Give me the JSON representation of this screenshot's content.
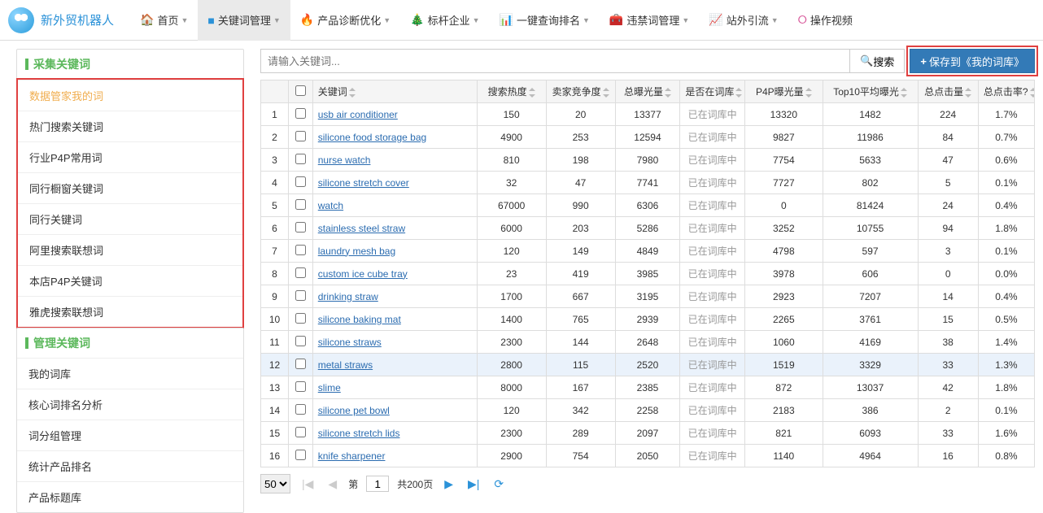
{
  "brand": "新外贸机器人",
  "nav": [
    {
      "label": "首页",
      "icon": "🏠",
      "color": "c-red",
      "caret": true
    },
    {
      "label": "关键词管理",
      "icon": "■",
      "color": "c-blue",
      "caret": true,
      "active": true
    },
    {
      "label": "产品诊断优化",
      "icon": "🔥",
      "color": "c-orange",
      "caret": true
    },
    {
      "label": "标杆企业",
      "icon": "🎄",
      "color": "c-green",
      "caret": true
    },
    {
      "label": "一键查询排名",
      "icon": "📊",
      "color": "c-orange",
      "caret": true
    },
    {
      "label": "违禁词管理",
      "icon": "🧰",
      "color": "c-red",
      "caret": true
    },
    {
      "label": "站外引流",
      "icon": "📈",
      "color": "c-teal",
      "caret": true
    },
    {
      "label": "操作视频",
      "icon": "⭘",
      "color": "c-pink",
      "caret": false
    }
  ],
  "sidebar": {
    "group1": {
      "title": "采集关键词",
      "items": [
        "数据管家我的词",
        "热门搜索关键词",
        "行业P4P常用词",
        "同行橱窗关键词",
        "同行关键词",
        "阿里搜索联想词",
        "本店P4P关键词",
        "雅虎搜索联想词"
      ]
    },
    "group2": {
      "title": "管理关键词",
      "items": [
        "我的词库",
        "核心词排名分析",
        "词分组管理",
        "统计产品排名",
        "产品标题库"
      ]
    }
  },
  "search": {
    "placeholder": "请输入关键词...",
    "btn_label": "搜索",
    "save_label": "保存到《我的词库》"
  },
  "columns": [
    "",
    "",
    "关键词",
    "搜索热度",
    "卖家竞争度",
    "总曝光量",
    "是否在词库",
    "P4P曝光量",
    "Top10平均曝光",
    "总点击量",
    "总点击率?"
  ],
  "rows": [
    {
      "n": 1,
      "kw": "usb air conditioner",
      "heat": "150",
      "comp": "20",
      "expo": "13377",
      "lib": "已在词库中",
      "p4p": "13320",
      "top10": "1482",
      "clk": "224",
      "ctr": "1.7%"
    },
    {
      "n": 2,
      "kw": "silicone food storage bag",
      "heat": "4900",
      "comp": "253",
      "expo": "12594",
      "lib": "已在词库中",
      "p4p": "9827",
      "top10": "11986",
      "clk": "84",
      "ctr": "0.7%"
    },
    {
      "n": 3,
      "kw": "nurse watch",
      "heat": "810",
      "comp": "198",
      "expo": "7980",
      "lib": "已在词库中",
      "p4p": "7754",
      "top10": "5633",
      "clk": "47",
      "ctr": "0.6%"
    },
    {
      "n": 4,
      "kw": "silicone stretch cover",
      "heat": "32",
      "comp": "47",
      "expo": "7741",
      "lib": "已在词库中",
      "p4p": "7727",
      "top10": "802",
      "clk": "5",
      "ctr": "0.1%"
    },
    {
      "n": 5,
      "kw": "watch",
      "heat": "67000",
      "comp": "990",
      "expo": "6306",
      "lib": "已在词库中",
      "p4p": "0",
      "top10": "81424",
      "clk": "24",
      "ctr": "0.4%"
    },
    {
      "n": 6,
      "kw": "stainless steel straw",
      "heat": "6000",
      "comp": "203",
      "expo": "5286",
      "lib": "已在词库中",
      "p4p": "3252",
      "top10": "10755",
      "clk": "94",
      "ctr": "1.8%"
    },
    {
      "n": 7,
      "kw": "laundry mesh bag",
      "heat": "120",
      "comp": "149",
      "expo": "4849",
      "lib": "已在词库中",
      "p4p": "4798",
      "top10": "597",
      "clk": "3",
      "ctr": "0.1%"
    },
    {
      "n": 8,
      "kw": "custom ice cube tray",
      "heat": "23",
      "comp": "419",
      "expo": "3985",
      "lib": "已在词库中",
      "p4p": "3978",
      "top10": "606",
      "clk": "0",
      "ctr": "0.0%"
    },
    {
      "n": 9,
      "kw": "drinking straw",
      "heat": "1700",
      "comp": "667",
      "expo": "3195",
      "lib": "已在词库中",
      "p4p": "2923",
      "top10": "7207",
      "clk": "14",
      "ctr": "0.4%"
    },
    {
      "n": 10,
      "kw": "silicone baking mat",
      "heat": "1400",
      "comp": "765",
      "expo": "2939",
      "lib": "已在词库中",
      "p4p": "2265",
      "top10": "3761",
      "clk": "15",
      "ctr": "0.5%"
    },
    {
      "n": 11,
      "kw": "silicone straws",
      "heat": "2300",
      "comp": "144",
      "expo": "2648",
      "lib": "已在词库中",
      "p4p": "1060",
      "top10": "4169",
      "clk": "38",
      "ctr": "1.4%"
    },
    {
      "n": 12,
      "kw": "metal straws",
      "heat": "2800",
      "comp": "115",
      "expo": "2520",
      "lib": "已在词库中",
      "p4p": "1519",
      "top10": "3329",
      "clk": "33",
      "ctr": "1.3%",
      "hovered": true
    },
    {
      "n": 13,
      "kw": "slime",
      "heat": "8000",
      "comp": "167",
      "expo": "2385",
      "lib": "已在词库中",
      "p4p": "872",
      "top10": "13037",
      "clk": "42",
      "ctr": "1.8%"
    },
    {
      "n": 14,
      "kw": "silicone pet bowl",
      "heat": "120",
      "comp": "342",
      "expo": "2258",
      "lib": "已在词库中",
      "p4p": "2183",
      "top10": "386",
      "clk": "2",
      "ctr": "0.1%"
    },
    {
      "n": 15,
      "kw": "silicone stretch lids",
      "heat": "2300",
      "comp": "289",
      "expo": "2097",
      "lib": "已在词库中",
      "p4p": "821",
      "top10": "6093",
      "clk": "33",
      "ctr": "1.6%"
    },
    {
      "n": 16,
      "kw": "knife sharpener",
      "heat": "2900",
      "comp": "754",
      "expo": "2050",
      "lib": "已在词库中",
      "p4p": "1140",
      "top10": "4964",
      "clk": "16",
      "ctr": "0.8%"
    }
  ],
  "pager": {
    "page_size": "50",
    "page_label_prefix": "第",
    "current": "1",
    "total_label": "共200页"
  }
}
